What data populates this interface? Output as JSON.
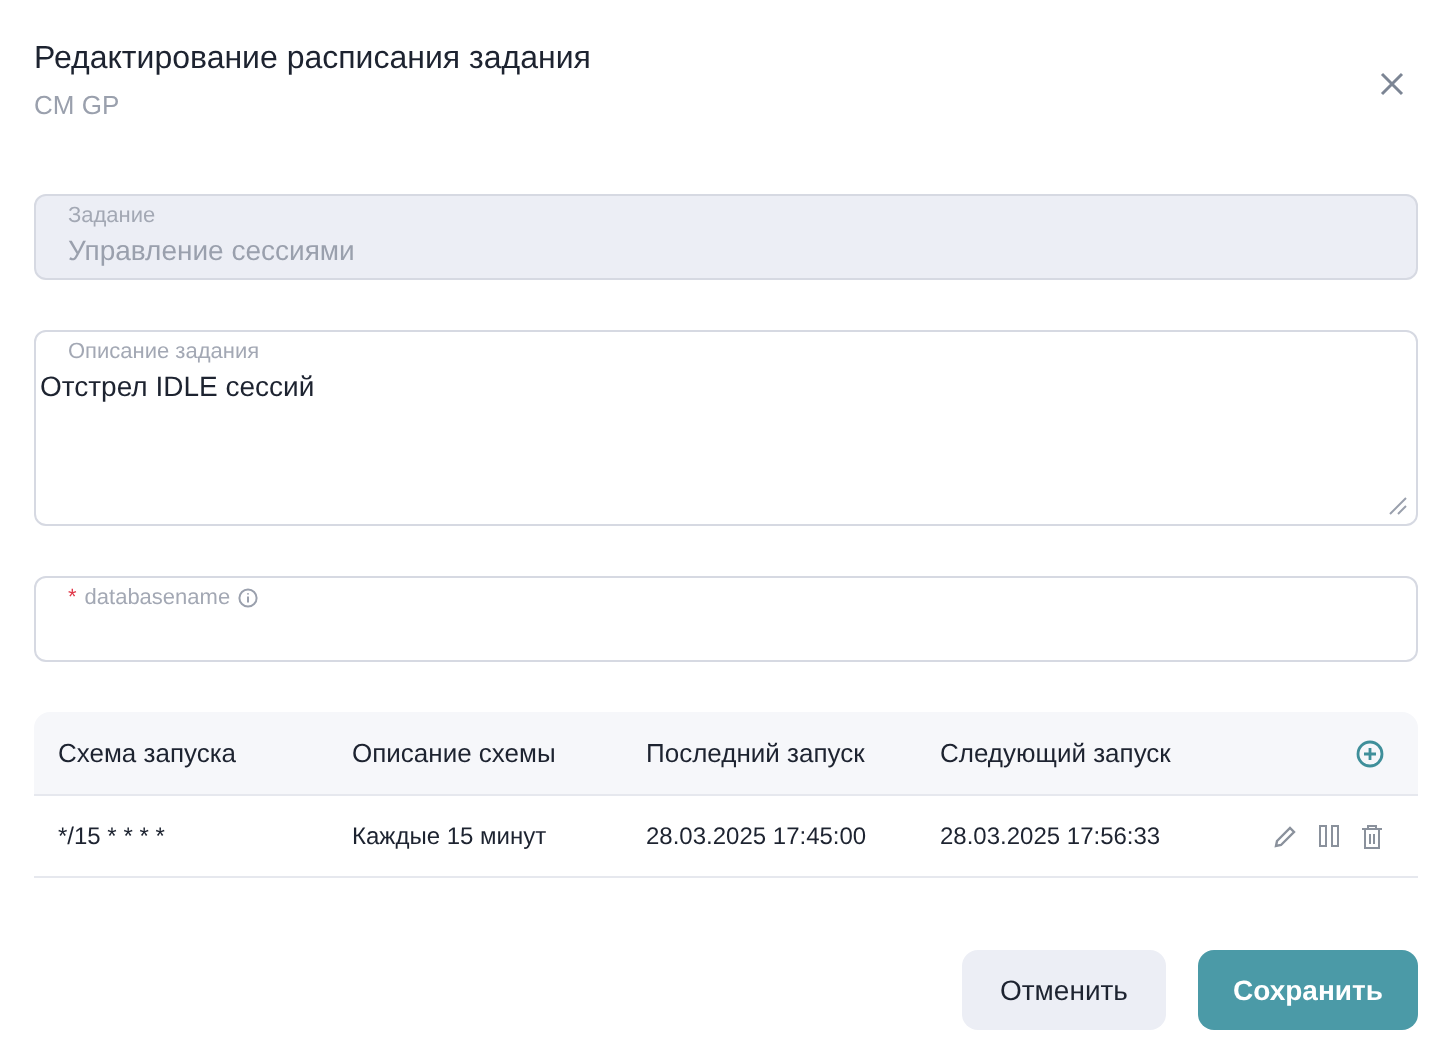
{
  "dialog": {
    "title": "Редактирование расписания задания",
    "subtitle": "CM GP"
  },
  "fields": [
    {
      "kind": "input",
      "label": "Задание",
      "value": "Управление сессиями",
      "disabled": true
    },
    {
      "kind": "textarea",
      "label": "Описание задания",
      "value": "Отстрел IDLE сессий",
      "disabled": false
    },
    {
      "kind": "input",
      "label": "databasename",
      "required_mark": "*",
      "info": true,
      "disabled": false
    }
  ],
  "table": {
    "columns": [
      "Схема запуска",
      "Описание схемы",
      "Последний запуск",
      "Следующий запуск"
    ],
    "rows": [
      {
        "cells": [
          "*/15 * * * *",
          "Каждые 15 минут",
          "28.03.2025 17:45:00",
          "28.03.2025 17:56:33"
        ]
      }
    ]
  },
  "buttons": [
    {
      "label": "Отменить",
      "kind": "secondary"
    },
    {
      "label": "Сохранить",
      "kind": "primary"
    }
  ]
}
